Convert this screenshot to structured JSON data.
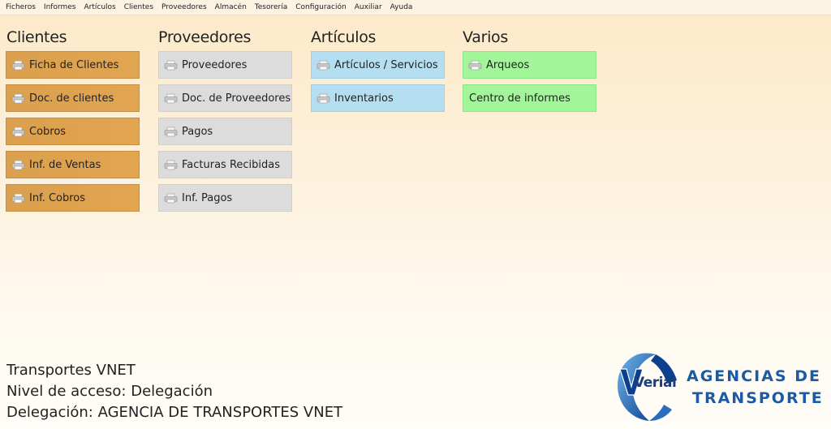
{
  "menu": [
    "Ficheros",
    "Informes",
    "Artículos",
    "Clientes",
    "Proveedores",
    "Almacén",
    "Tesorería",
    "Configuración",
    "Auxiliar",
    "Ayuda"
  ],
  "sections": {
    "clientes": {
      "title": "Clientes",
      "tiles": [
        "Ficha de Clientes",
        "Doc. de clientes",
        "Cobros",
        "Inf. de Ventas",
        "Inf. Cobros"
      ]
    },
    "proveedores": {
      "title": "Proveedores",
      "tiles": [
        "Proveedores",
        "Doc. de Proveedores",
        "Pagos",
        "Facturas Recibidas",
        "Inf. Pagos"
      ]
    },
    "articulos": {
      "title": "Artículos",
      "tiles": [
        "Artículos / Servicios",
        "Inventarios"
      ]
    },
    "varios": {
      "title": "Varios",
      "tiles": [
        "Arqueos",
        "Centro de informes"
      ]
    }
  },
  "footer": {
    "company": "Transportes VNET",
    "access_level": "Nivel de acceso: Delegación",
    "delegation": "Delegación: AGENCIA DE TRANSPORTES VNET"
  },
  "brand": {
    "logo_text": "Verial",
    "line1": "AGENCIAS DE",
    "line2": "TRANSPORTE"
  },
  "colors": {
    "clientes": "#dba04e",
    "proveedores": "#dcdcdc",
    "articulos": "#b5dff0",
    "varios": "#a3f59a",
    "brand": "#1c5aa5"
  }
}
